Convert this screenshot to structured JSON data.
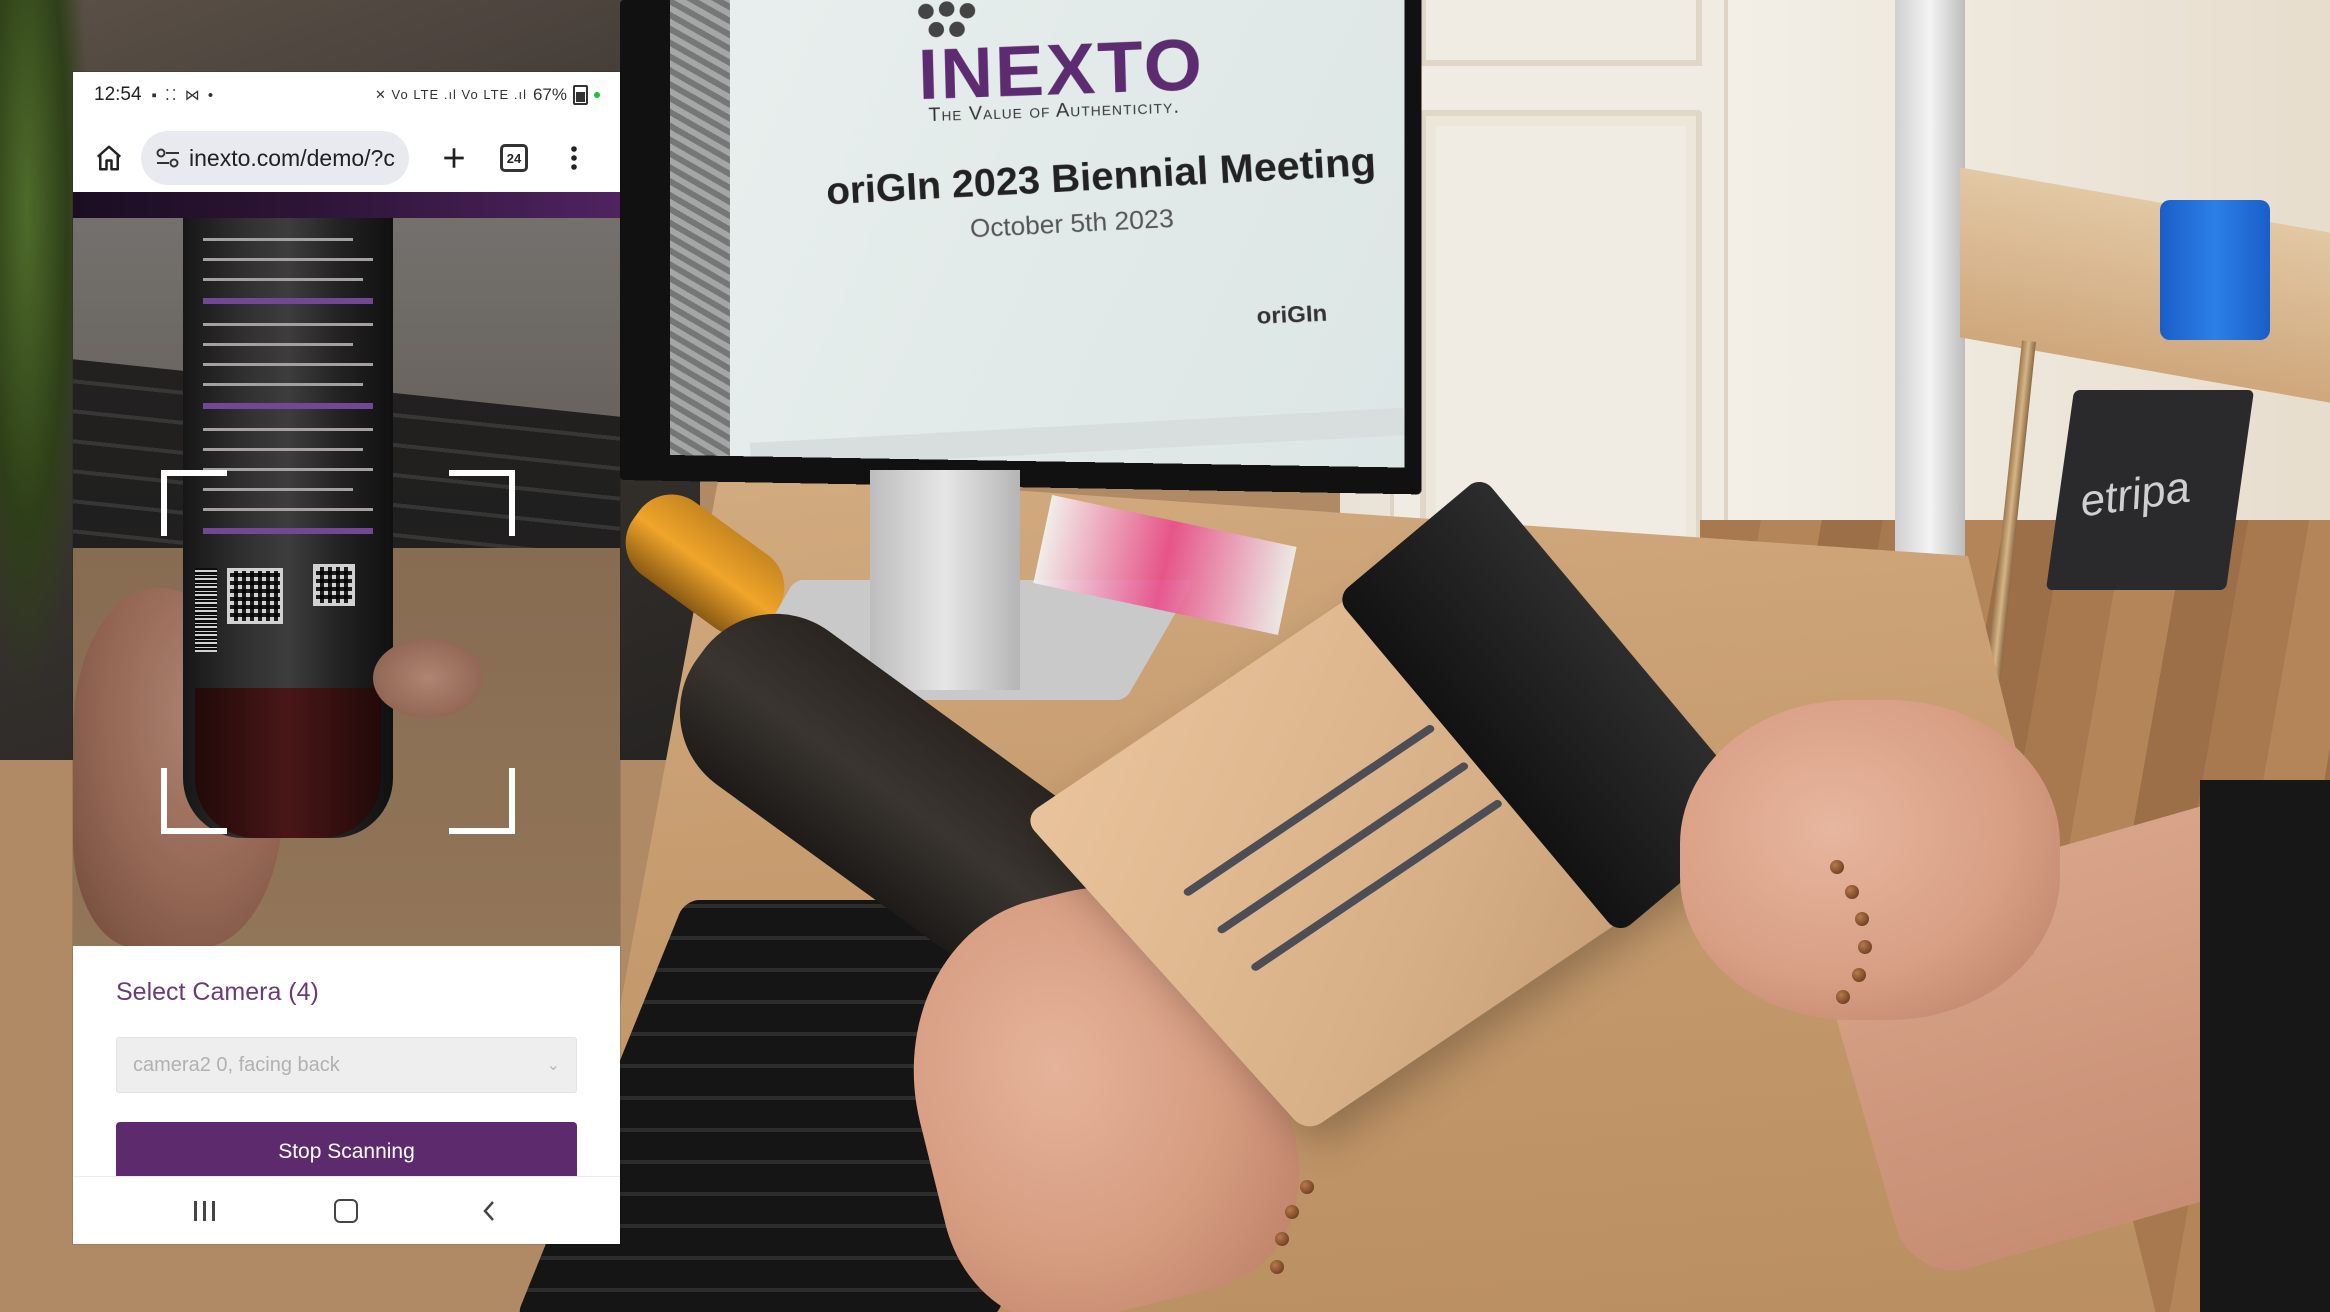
{
  "background_scene": {
    "monitor_brand": "INEXTO",
    "monitor_tagline": "The Value of Authenticity.",
    "monitor_title": "oriGIn 2023 Biennial Meeting",
    "monitor_date": "October 5th 2023",
    "monitor_logo": "oriGIn",
    "bin_text": "etripa"
  },
  "phone": {
    "status_bar": {
      "time": "12:54",
      "left_icons": "▪ ⁚⁚ ⋈ •",
      "right_icons": "✕ Vo LTE .ıl Vo LTE .ıl",
      "battery": "67%"
    },
    "browser": {
      "url": "inexto.com/demo/?c",
      "tab_count": "24"
    },
    "scanner": {
      "select_label": "Select Camera (4)",
      "selected_camera": "camera2 0, facing back",
      "stop_button": "Stop Scanning"
    }
  },
  "colors": {
    "accent_purple": "#5d2a6e",
    "label_purple": "#6b3a78"
  }
}
